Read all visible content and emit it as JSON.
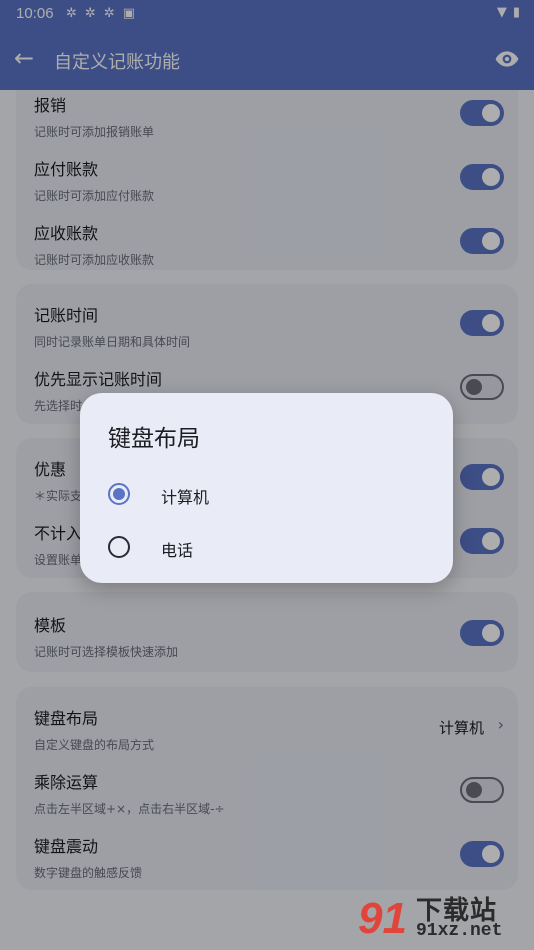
{
  "status": {
    "time": "10:06",
    "icons": [
      "notification-icon",
      "notification-icon",
      "notification-icon",
      "app-icon"
    ],
    "right_icons": [
      "wifi-icon",
      "battery-icon"
    ]
  },
  "appbar": {
    "title": "自定义记账功能"
  },
  "sections": [
    {
      "items": [
        {
          "title": "报销",
          "subtitle": "记账时可添加报销账单",
          "switch": "on"
        },
        {
          "title": "应付账款",
          "subtitle": "记账时可添加应付账款",
          "switch": "on"
        },
        {
          "title": "应收账款",
          "subtitle": "记账时可添加应收账款",
          "switch": "on"
        }
      ]
    },
    {
      "items": [
        {
          "title": "记账时间",
          "subtitle": "同时记录账单日期和具体时间",
          "switch": "on"
        },
        {
          "title": "优先显示记账时间",
          "subtitle": "先选择时",
          "switch": "off"
        }
      ]
    },
    {
      "items": [
        {
          "title": "优惠",
          "subtitle": "＊实际支",
          "switch": "on"
        },
        {
          "title": "不计入",
          "subtitle": "设置账单",
          "switch": "on"
        }
      ]
    },
    {
      "items": [
        {
          "title": "模板",
          "subtitle": "记账时可选择模板快速添加",
          "switch": "on"
        }
      ]
    },
    {
      "items": [
        {
          "title": "键盘布局",
          "subtitle": "自定义键盘的布局方式",
          "value": "计算机"
        },
        {
          "title": "乘除运算",
          "subtitle": "点击左半区域+×，点击右半区域-÷",
          "switch": "off"
        },
        {
          "title": "键盘震动",
          "subtitle": "数字键盘的触感反馈",
          "switch": "on"
        }
      ]
    }
  ],
  "dialog": {
    "title": "键盘布局",
    "options": [
      {
        "label": "计算机",
        "selected": true
      },
      {
        "label": "电话",
        "selected": false
      }
    ]
  },
  "watermark": {
    "logo": "91",
    "text": "下载站",
    "url": "91xz.net"
  },
  "colors": {
    "primary": "#5b73c6",
    "card": "#e8eaf4",
    "dialog": "#e9ecf6"
  }
}
